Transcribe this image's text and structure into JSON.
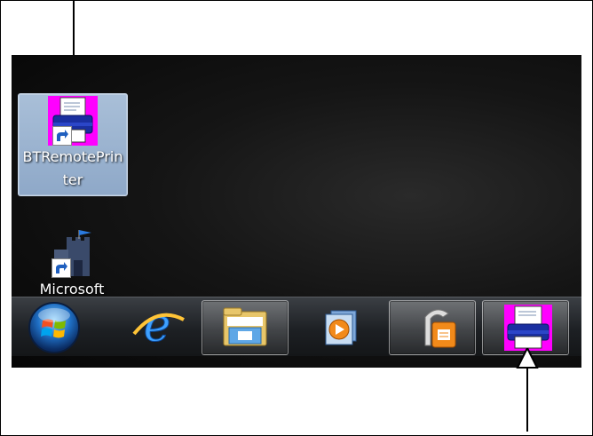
{
  "desktop": {
    "icons": [
      {
        "label": "BTRemotePrinter",
        "selected": true
      },
      {
        "label": "Microsoft",
        "selected": false
      }
    ]
  },
  "taskbar": {
    "items": [
      {
        "name": "start-button"
      },
      {
        "name": "internet-explorer"
      },
      {
        "name": "windows-explorer"
      },
      {
        "name": "media-player"
      },
      {
        "name": "office-app"
      },
      {
        "name": "btremoteprinter-app"
      }
    ]
  },
  "colors": {
    "printer_magenta": "#ff00ff",
    "selection_blue": "#9ab2cf",
    "desktop_bg": "#111111"
  }
}
